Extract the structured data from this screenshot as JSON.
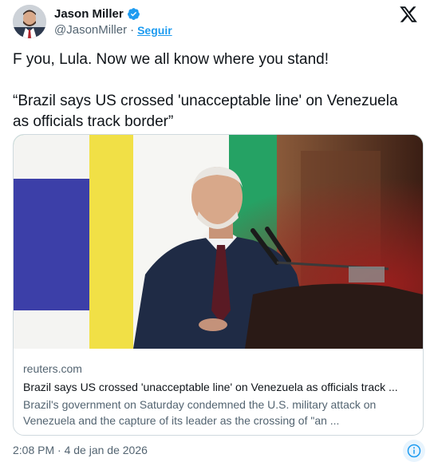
{
  "author": {
    "display_name": "Jason Miller",
    "handle": "@JasonMiller",
    "separator": "·",
    "follow_label": "Seguir",
    "avatar_icon": "profile-photo",
    "verified_icon": "verified-badge-icon"
  },
  "tweet": {
    "text_line_1": "F you, Lula. Now we all know where you stand!",
    "text_line_2": "“Brazil says US crossed 'unacceptable line' on Venezuela as officials track border”"
  },
  "card": {
    "domain": "reuters.com",
    "title": "Brazil says US crossed 'unacceptable line' on Venezuela as officials track ...",
    "description": "Brazil's government on Saturday condemned the U.S. military attack on Venezuela and the capture of its leader as the crossing of \"an ..."
  },
  "footer": {
    "timestamp": "2:08 PM · 4 de jan de 2026"
  },
  "colors": {
    "accent": "#1d9bf0",
    "text_primary": "#0f1419",
    "text_secondary": "#536471",
    "border": "#cfd9de"
  }
}
